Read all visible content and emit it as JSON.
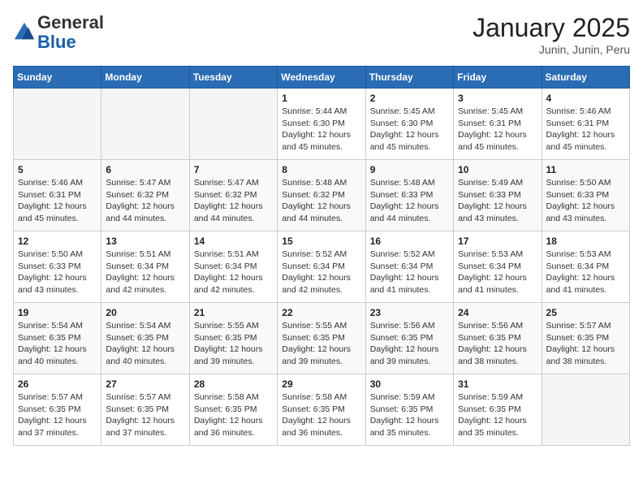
{
  "logo": {
    "general": "General",
    "blue": "Blue"
  },
  "header": {
    "month": "January 2025",
    "location": "Junin, Junin, Peru"
  },
  "weekdays": [
    "Sunday",
    "Monday",
    "Tuesday",
    "Wednesday",
    "Thursday",
    "Friday",
    "Saturday"
  ],
  "weeks": [
    [
      {
        "day": "",
        "info": ""
      },
      {
        "day": "",
        "info": ""
      },
      {
        "day": "",
        "info": ""
      },
      {
        "day": "1",
        "info": "Sunrise: 5:44 AM\nSunset: 6:30 PM\nDaylight: 12 hours\nand 45 minutes."
      },
      {
        "day": "2",
        "info": "Sunrise: 5:45 AM\nSunset: 6:30 PM\nDaylight: 12 hours\nand 45 minutes."
      },
      {
        "day": "3",
        "info": "Sunrise: 5:45 AM\nSunset: 6:31 PM\nDaylight: 12 hours\nand 45 minutes."
      },
      {
        "day": "4",
        "info": "Sunrise: 5:46 AM\nSunset: 6:31 PM\nDaylight: 12 hours\nand 45 minutes."
      }
    ],
    [
      {
        "day": "5",
        "info": "Sunrise: 5:46 AM\nSunset: 6:31 PM\nDaylight: 12 hours\nand 45 minutes."
      },
      {
        "day": "6",
        "info": "Sunrise: 5:47 AM\nSunset: 6:32 PM\nDaylight: 12 hours\nand 44 minutes."
      },
      {
        "day": "7",
        "info": "Sunrise: 5:47 AM\nSunset: 6:32 PM\nDaylight: 12 hours\nand 44 minutes."
      },
      {
        "day": "8",
        "info": "Sunrise: 5:48 AM\nSunset: 6:32 PM\nDaylight: 12 hours\nand 44 minutes."
      },
      {
        "day": "9",
        "info": "Sunrise: 5:48 AM\nSunset: 6:33 PM\nDaylight: 12 hours\nand 44 minutes."
      },
      {
        "day": "10",
        "info": "Sunrise: 5:49 AM\nSunset: 6:33 PM\nDaylight: 12 hours\nand 43 minutes."
      },
      {
        "day": "11",
        "info": "Sunrise: 5:50 AM\nSunset: 6:33 PM\nDaylight: 12 hours\nand 43 minutes."
      }
    ],
    [
      {
        "day": "12",
        "info": "Sunrise: 5:50 AM\nSunset: 6:33 PM\nDaylight: 12 hours\nand 43 minutes."
      },
      {
        "day": "13",
        "info": "Sunrise: 5:51 AM\nSunset: 6:34 PM\nDaylight: 12 hours\nand 42 minutes."
      },
      {
        "day": "14",
        "info": "Sunrise: 5:51 AM\nSunset: 6:34 PM\nDaylight: 12 hours\nand 42 minutes."
      },
      {
        "day": "15",
        "info": "Sunrise: 5:52 AM\nSunset: 6:34 PM\nDaylight: 12 hours\nand 42 minutes."
      },
      {
        "day": "16",
        "info": "Sunrise: 5:52 AM\nSunset: 6:34 PM\nDaylight: 12 hours\nand 41 minutes."
      },
      {
        "day": "17",
        "info": "Sunrise: 5:53 AM\nSunset: 6:34 PM\nDaylight: 12 hours\nand 41 minutes."
      },
      {
        "day": "18",
        "info": "Sunrise: 5:53 AM\nSunset: 6:34 PM\nDaylight: 12 hours\nand 41 minutes."
      }
    ],
    [
      {
        "day": "19",
        "info": "Sunrise: 5:54 AM\nSunset: 6:35 PM\nDaylight: 12 hours\nand 40 minutes."
      },
      {
        "day": "20",
        "info": "Sunrise: 5:54 AM\nSunset: 6:35 PM\nDaylight: 12 hours\nand 40 minutes."
      },
      {
        "day": "21",
        "info": "Sunrise: 5:55 AM\nSunset: 6:35 PM\nDaylight: 12 hours\nand 39 minutes."
      },
      {
        "day": "22",
        "info": "Sunrise: 5:55 AM\nSunset: 6:35 PM\nDaylight: 12 hours\nand 39 minutes."
      },
      {
        "day": "23",
        "info": "Sunrise: 5:56 AM\nSunset: 6:35 PM\nDaylight: 12 hours\nand 39 minutes."
      },
      {
        "day": "24",
        "info": "Sunrise: 5:56 AM\nSunset: 6:35 PM\nDaylight: 12 hours\nand 38 minutes."
      },
      {
        "day": "25",
        "info": "Sunrise: 5:57 AM\nSunset: 6:35 PM\nDaylight: 12 hours\nand 38 minutes."
      }
    ],
    [
      {
        "day": "26",
        "info": "Sunrise: 5:57 AM\nSunset: 6:35 PM\nDaylight: 12 hours\nand 37 minutes."
      },
      {
        "day": "27",
        "info": "Sunrise: 5:57 AM\nSunset: 6:35 PM\nDaylight: 12 hours\nand 37 minutes."
      },
      {
        "day": "28",
        "info": "Sunrise: 5:58 AM\nSunset: 6:35 PM\nDaylight: 12 hours\nand 36 minutes."
      },
      {
        "day": "29",
        "info": "Sunrise: 5:58 AM\nSunset: 6:35 PM\nDaylight: 12 hours\nand 36 minutes."
      },
      {
        "day": "30",
        "info": "Sunrise: 5:59 AM\nSunset: 6:35 PM\nDaylight: 12 hours\nand 35 minutes."
      },
      {
        "day": "31",
        "info": "Sunrise: 5:59 AM\nSunset: 6:35 PM\nDaylight: 12 hours\nand 35 minutes."
      },
      {
        "day": "",
        "info": ""
      }
    ]
  ]
}
